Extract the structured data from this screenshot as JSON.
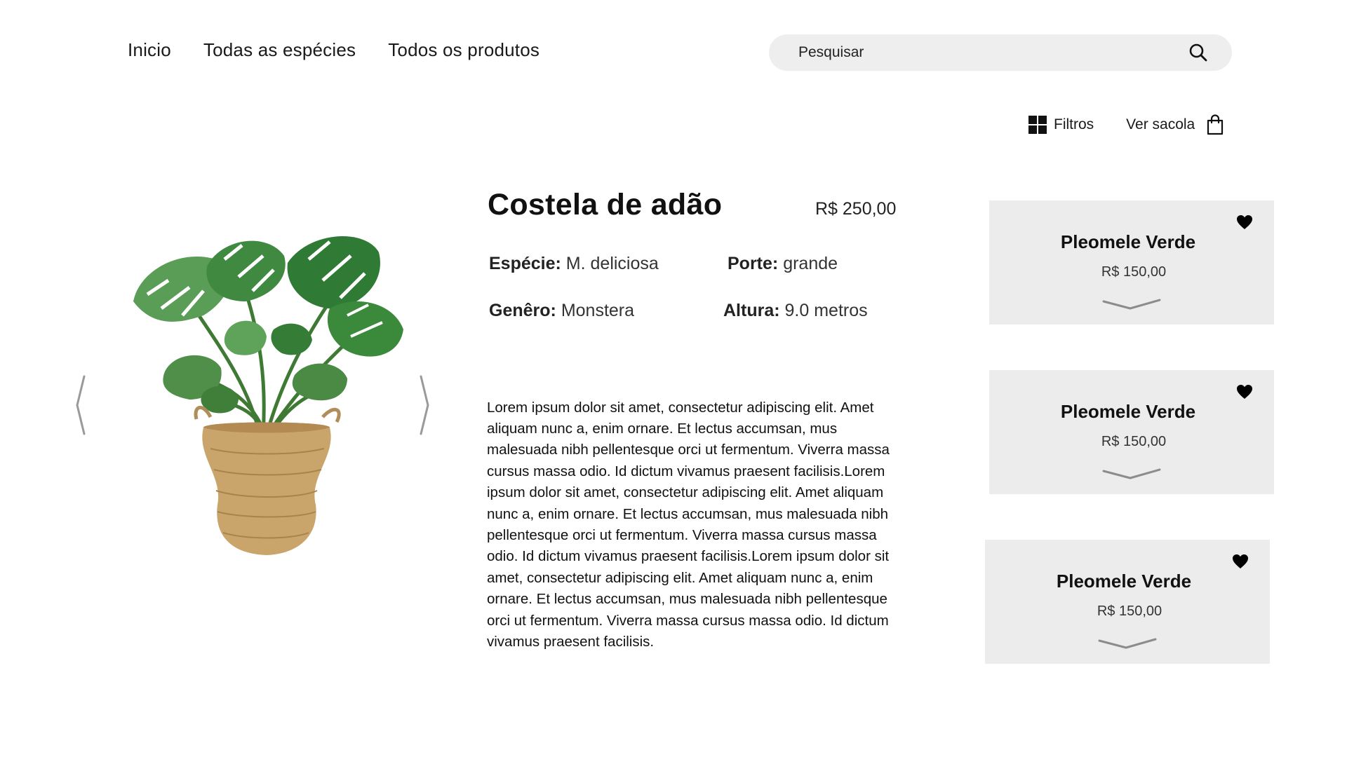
{
  "nav": {
    "items": [
      {
        "label": "Inicio"
      },
      {
        "label": "Todas as espécies"
      },
      {
        "label": "Todos os produtos"
      }
    ]
  },
  "search": {
    "placeholder": "Pesquisar",
    "icon": "search-icon"
  },
  "toolbar": {
    "filters_label": "Filtros",
    "filters_icon": "grid-icon",
    "bag_label": "Ver sacola",
    "bag_icon": "shopping-bag-icon"
  },
  "carousel": {
    "image": "plant-image",
    "prev_icon": "chevron-left-icon",
    "next_icon": "chevron-right-icon"
  },
  "product": {
    "title": "Costela de adão",
    "price": "R$ 250,00",
    "attributes": {
      "especie_label": "Espécie:",
      "especie_value": "M. deliciosa",
      "porte_label": "Porte:",
      "porte_value": "grande",
      "genero_label": "Genêro:",
      "genero_value": "Monstera",
      "altura_label": "Altura:",
      "altura_value": "9.0 metros"
    },
    "description": "Lorem ipsum dolor sit amet, consectetur adipiscing elit. Amet aliquam nunc a, enim ornare. Et lectus accumsan, mus malesuada nibh pellentesque orci ut fermentum. Viverra massa cursus massa odio. Id dictum vivamus praesent facilisis.Lorem ipsum dolor sit amet, consectetur adipiscing elit. Amet aliquam nunc a, enim ornare. Et lectus accumsan, mus malesuada nibh pellentesque orci ut fermentum. Viverra massa cursus massa odio. Id dictum vivamus praesent facilisis.Lorem ipsum dolor sit amet, consectetur adipiscing elit. Amet aliquam nunc a, enim ornare. Et lectus accumsan, mus malesuada nibh pellentesque orci ut fermentum. Viverra massa cursus massa odio. Id dictum vivamus praesent facilisis."
  },
  "related": {
    "cards": [
      {
        "name": "Pleomele Verde",
        "price": "R$ 150,00",
        "icon": "heart-icon",
        "expand_icon": "chevron-down-icon"
      },
      {
        "name": "Pleomele Verde",
        "price": "R$ 150,00",
        "icon": "heart-icon",
        "expand_icon": "chevron-down-icon"
      },
      {
        "name": "Pleomele Verde",
        "price": "R$ 150,00",
        "icon": "heart-icon",
        "expand_icon": "chevron-down-icon"
      }
    ]
  },
  "colors": {
    "background": "#ffffff",
    "search_bg": "#eeeeee",
    "card_bg": "#ececec",
    "text": "#111111",
    "arrow": "#9a9a9a"
  }
}
